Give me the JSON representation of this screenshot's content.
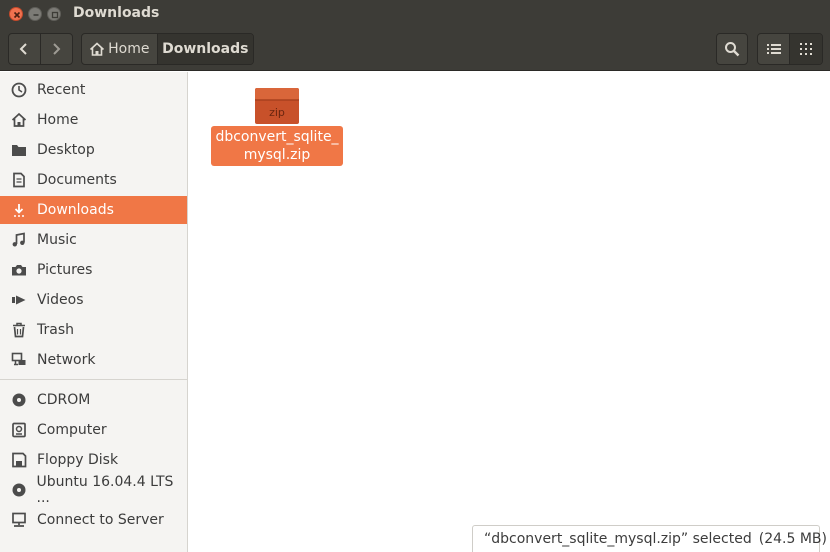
{
  "window": {
    "title": "Downloads"
  },
  "toolbar": {
    "back_icon": "chevron-left-icon",
    "forward_icon": "chevron-right-icon",
    "path": {
      "home_label": "Home",
      "current_label": "Downloads"
    },
    "search_icon": "search-icon",
    "list_view_icon": "list-view-icon",
    "grid_view_icon": "grid-view-icon"
  },
  "sidebar": {
    "items": [
      {
        "label": "Recent",
        "icon": "clock-icon"
      },
      {
        "label": "Home",
        "icon": "home-icon"
      },
      {
        "label": "Desktop",
        "icon": "folder-icon"
      },
      {
        "label": "Documents",
        "icon": "document-icon"
      },
      {
        "label": "Downloads",
        "icon": "download-icon",
        "active": true
      },
      {
        "label": "Music",
        "icon": "music-icon"
      },
      {
        "label": "Pictures",
        "icon": "camera-icon"
      },
      {
        "label": "Videos",
        "icon": "video-icon"
      },
      {
        "label": "Trash",
        "icon": "trash-icon"
      },
      {
        "label": "Network",
        "icon": "network-icon"
      }
    ],
    "devices": [
      {
        "label": "CDROM",
        "icon": "disc-icon"
      },
      {
        "label": "Computer",
        "icon": "drive-icon"
      },
      {
        "label": "Floppy Disk",
        "icon": "floppy-icon"
      },
      {
        "label": "Ubuntu 16.04.4 LTS ...",
        "icon": "disc-icon"
      },
      {
        "label": "Connect to Server",
        "icon": "server-icon"
      }
    ]
  },
  "files": [
    {
      "name": "dbconvert_sqlite_mysql.zip",
      "name_line1": "dbconvert_sqlite_",
      "name_line2": "mysql.zip",
      "icon_label": "zip",
      "selected": true
    }
  ],
  "status": {
    "text": "“dbconvert_sqlite_mysql.zip” selected",
    "size": "(24.5 MB)"
  },
  "colors": {
    "accent": "#f07746",
    "titlebar": "#3d3c37",
    "sidebar_bg": "#f5f4f2"
  }
}
